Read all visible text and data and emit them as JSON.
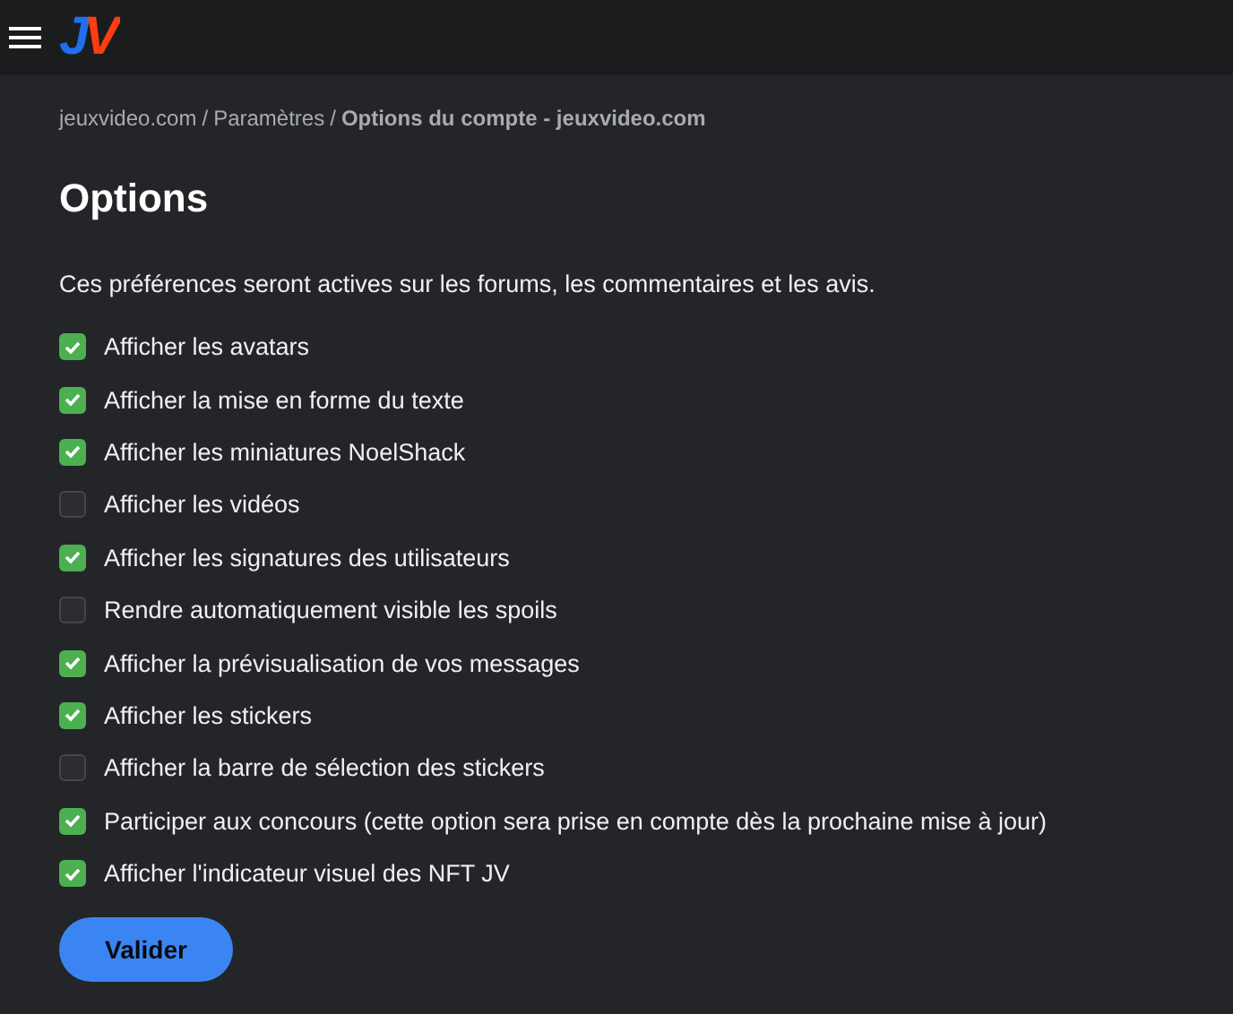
{
  "header": {
    "logo": "JV"
  },
  "breadcrumb": [
    {
      "label": "jeuxvideo.com",
      "current": false
    },
    {
      "label": "Paramètres",
      "current": false
    },
    {
      "label": "Options du compte - jeuxvideo.com",
      "current": true
    }
  ],
  "breadcrumb_separator": "/",
  "title": "Options",
  "description": "Ces préférences seront actives sur les forums, les commentaires et les avis.",
  "options": [
    {
      "label": "Afficher les avatars",
      "checked": true
    },
    {
      "label": "Afficher la mise en forme du texte",
      "checked": true
    },
    {
      "label": "Afficher les miniatures NoelShack",
      "checked": true
    },
    {
      "label": "Afficher les vidéos",
      "checked": false
    },
    {
      "label": "Afficher les signatures des utilisateurs",
      "checked": true
    },
    {
      "label": "Rendre automatiquement visible les spoils",
      "checked": false
    },
    {
      "label": "Afficher la prévisualisation de vos messages",
      "checked": true
    },
    {
      "label": "Afficher les stickers",
      "checked": true
    },
    {
      "label": "Afficher la barre de sélection des stickers",
      "checked": false
    },
    {
      "label": "Participer aux concours (cette option sera prise en compte dès la prochaine mise à jour)",
      "checked": true
    },
    {
      "label": "Afficher l'indicateur visuel des NFT JV",
      "checked": true
    }
  ],
  "submit": "Valider"
}
